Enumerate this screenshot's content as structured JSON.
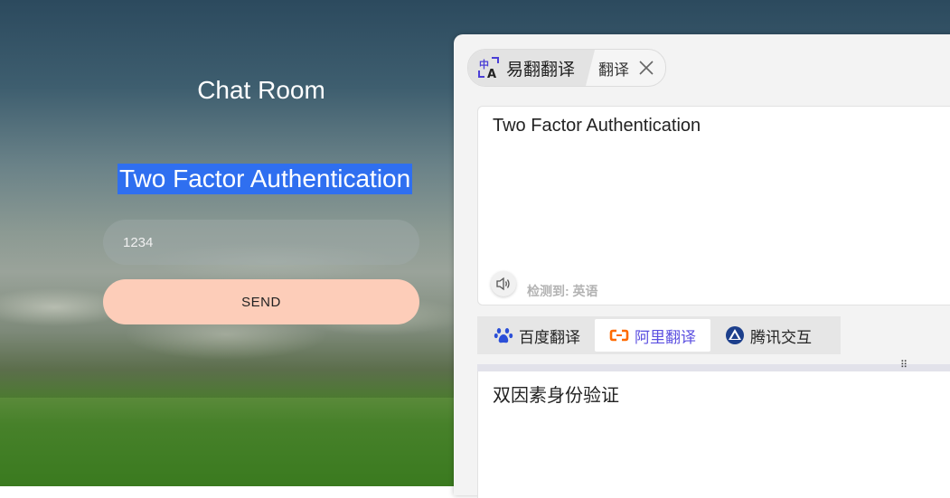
{
  "chat": {
    "title": "Chat Room",
    "heading": "Two Factor Authentication",
    "code_value": "1234",
    "send_label": "SEND"
  },
  "translator": {
    "app_tab_label": "易翻翻译",
    "translate_tab_label": "翻译",
    "source_text": "Two Factor Authentication",
    "detect_label": "检测到: 英语",
    "engines": [
      {
        "label": "百度翻译",
        "icon": "baidu-paw-icon",
        "active": false
      },
      {
        "label": "阿里翻译",
        "icon": "alibaba-icon",
        "active": true
      },
      {
        "label": "腾讯交互",
        "icon": "tencent-icon",
        "active": false
      }
    ],
    "result_text": "双因素身份验证",
    "accent_color": "#5b4fe0"
  },
  "colors": {
    "highlight": "#2f6ff0",
    "send_button": "#fdcdb9"
  }
}
